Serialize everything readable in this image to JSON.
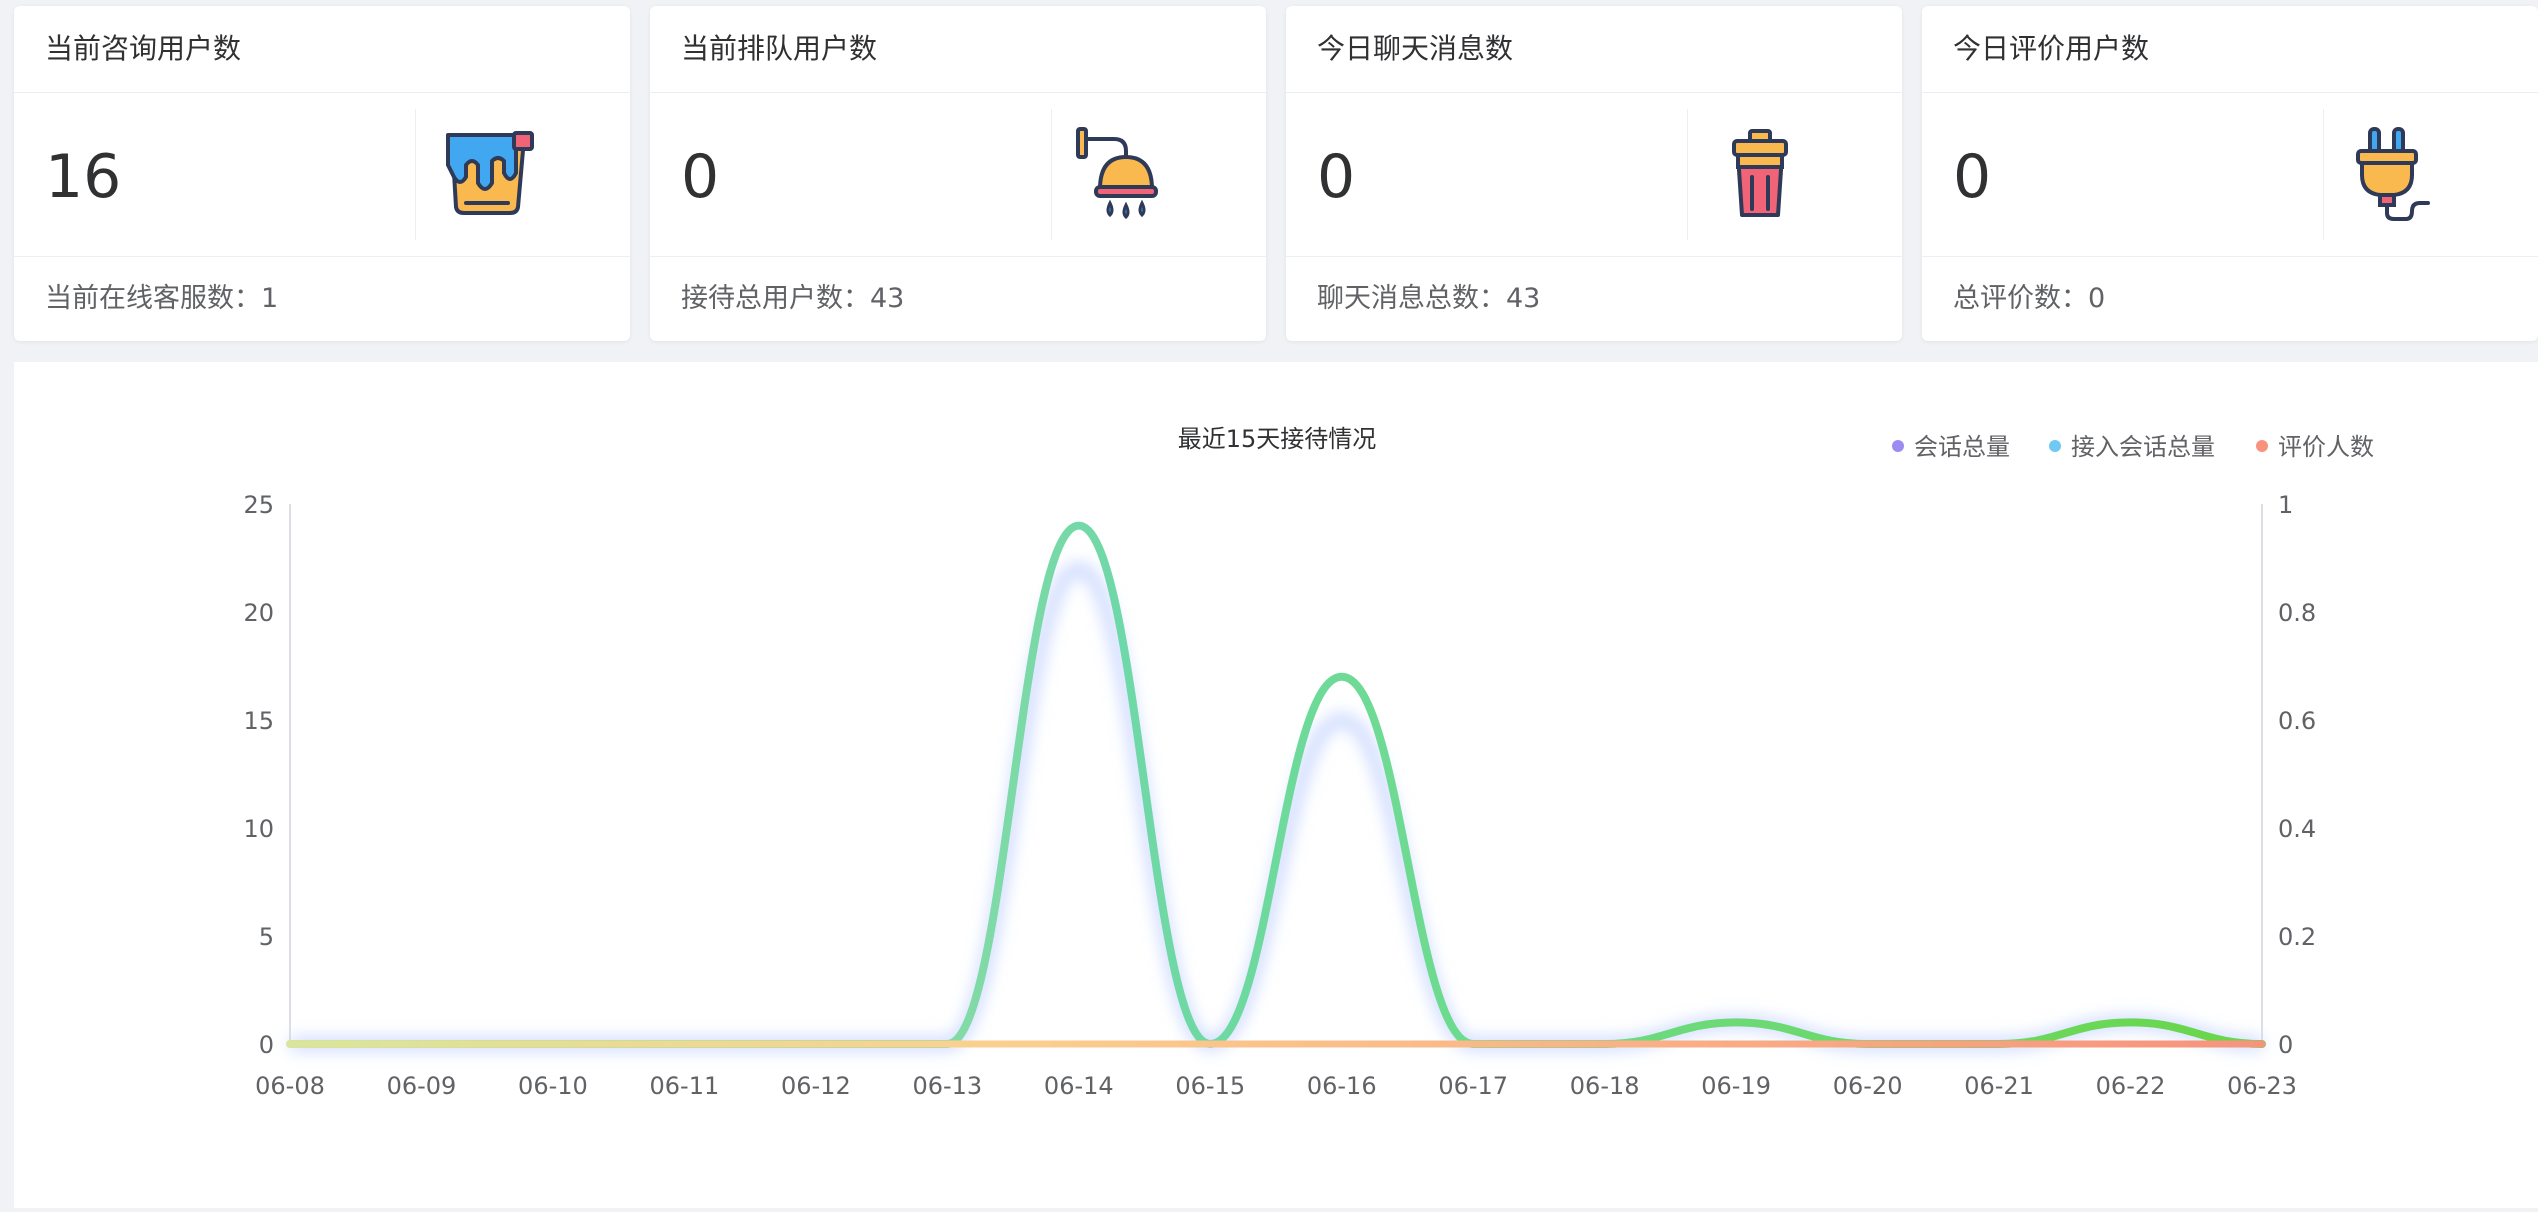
{
  "cards": [
    {
      "title": "当前咨询用户数",
      "value": "16",
      "footer": "当前在线客服数：1",
      "icon": "paint-bucket-icon"
    },
    {
      "title": "当前排队用户数",
      "value": "0",
      "footer": "接待总用户数：43",
      "icon": "shower-icon"
    },
    {
      "title": "今日聊天消息数",
      "value": "0",
      "footer": "聊天消息总数：43",
      "icon": "trash-bin-icon"
    },
    {
      "title": "今日评价用户数",
      "value": "0",
      "footer": "总评价数：0",
      "icon": "plug-icon"
    }
  ],
  "chart_data": {
    "type": "line",
    "title": "最近15天接待情况",
    "legend_position": "top-right",
    "categories": [
      "06-08",
      "06-09",
      "06-10",
      "06-11",
      "06-12",
      "06-13",
      "06-14",
      "06-15",
      "06-16",
      "06-17",
      "06-18",
      "06-19",
      "06-20",
      "06-21",
      "06-22",
      "06-23"
    ],
    "series": [
      {
        "name": "会话总量",
        "color": "#9b8cf2",
        "axis": "left",
        "values": [
          0,
          0,
          0,
          0,
          0,
          0,
          22,
          0,
          15,
          0,
          0,
          1,
          0,
          0,
          1,
          0
        ]
      },
      {
        "name": "接入会话总量",
        "color": "#6fc9f5",
        "axis": "left",
        "values": [
          0,
          0,
          0,
          0,
          0,
          0,
          24,
          0,
          17,
          0,
          0,
          1,
          0,
          0,
          1,
          0
        ]
      },
      {
        "name": "评价人数",
        "color": "#f7937d",
        "axis": "right",
        "values": [
          0,
          0,
          0,
          0,
          0,
          0,
          0,
          0,
          0,
          0,
          0,
          0,
          0,
          0,
          0,
          0
        ]
      }
    ],
    "y_left": {
      "min": 0,
      "max": 25,
      "ticks": [
        "0",
        "5",
        "10",
        "15",
        "20",
        "25"
      ]
    },
    "y_right": {
      "min": 0,
      "max": 1,
      "ticks": [
        "0",
        "0.2",
        "0.4",
        "0.6",
        "0.8",
        "1"
      ]
    },
    "grid": false
  }
}
